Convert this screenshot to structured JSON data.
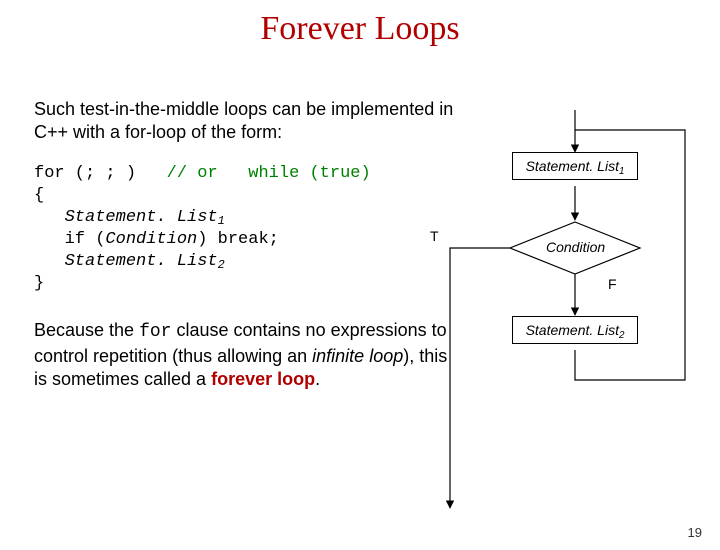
{
  "title": "Forever Loops",
  "para1": "Such test-in-the-middle loops can be implemented in C++ with a for-loop of the form:",
  "code": {
    "l1_for": "for (; ; )",
    "l1_comment": "// or",
    "l1_while": "while (true)",
    "l2": "{",
    "l3_stmt": "Statement. List",
    "l3_sub": "1",
    "l4a": "if (",
    "l4b": "Condition",
    "l4c": ") break;",
    "l5_stmt": "Statement. List",
    "l5_sub": "2",
    "l6": "}"
  },
  "para2_a": "Because the ",
  "para2_for": "for",
  "para2_b": " clause contains no expressions to control repetition (thus allowing an ",
  "para2_inf": "infinite loop",
  "para2_c": "), this is sometimes called a ",
  "para2_forever": "forever loop",
  "para2_d": ".",
  "diagram": {
    "node1": "Statement. List",
    "node1_sub": "1",
    "condition": "Condition",
    "node2": "Statement. List",
    "node2_sub": "2",
    "t_label": "T",
    "f_label": "F"
  },
  "slide_number": "19"
}
